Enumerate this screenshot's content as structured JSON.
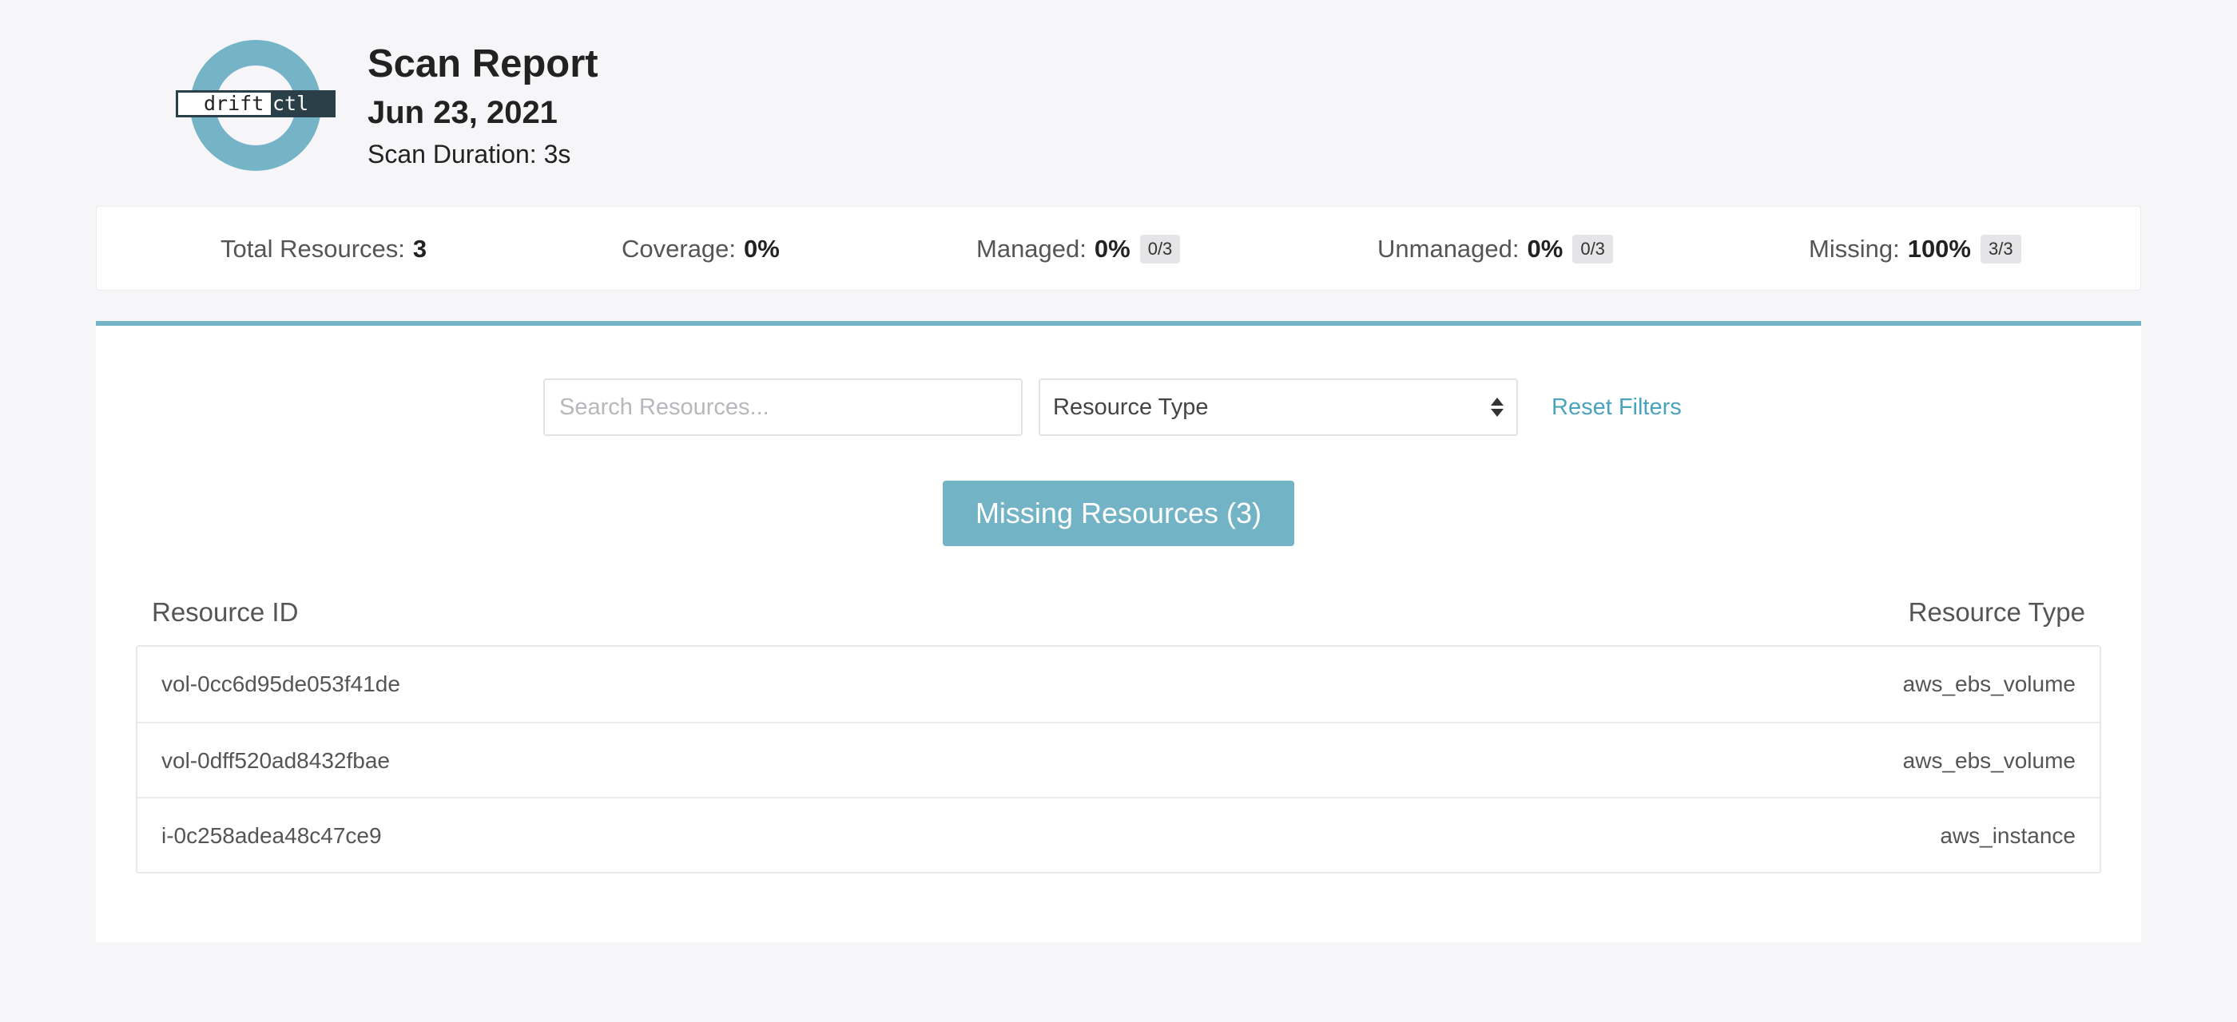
{
  "logo": {
    "part1": "drift",
    "part2": "ctl"
  },
  "header": {
    "title": "Scan Report",
    "date": "Jun 23, 2021",
    "duration": "Scan Duration: 3s"
  },
  "summary": {
    "total_label": "Total Resources:",
    "total_value": "3",
    "coverage_label": "Coverage:",
    "coverage_value": "0%",
    "managed_label": "Managed:",
    "managed_value": "0%",
    "managed_badge": "0/3",
    "unmanaged_label": "Unmanaged:",
    "unmanaged_value": "0%",
    "unmanaged_badge": "0/3",
    "missing_label": "Missing:",
    "missing_value": "100%",
    "missing_badge": "3/3"
  },
  "filters": {
    "search_placeholder": "Search Resources...",
    "resource_type": "Resource Type",
    "reset_label": "Reset Filters"
  },
  "missing_button": "Missing Resources (3)",
  "table": {
    "col_id": "Resource ID",
    "col_type": "Resource Type",
    "rows": [
      {
        "id": "vol-0cc6d95de053f41de",
        "type": "aws_ebs_volume"
      },
      {
        "id": "vol-0dff520ad8432fbae",
        "type": "aws_ebs_volume"
      },
      {
        "id": "i-0c258adea48c47ce9",
        "type": "aws_instance"
      }
    ]
  },
  "colors": {
    "accent": "#74b4c6",
    "link": "#4aa3bd",
    "logo_dark": "#2a3f48",
    "background": "#f6f6f8"
  }
}
